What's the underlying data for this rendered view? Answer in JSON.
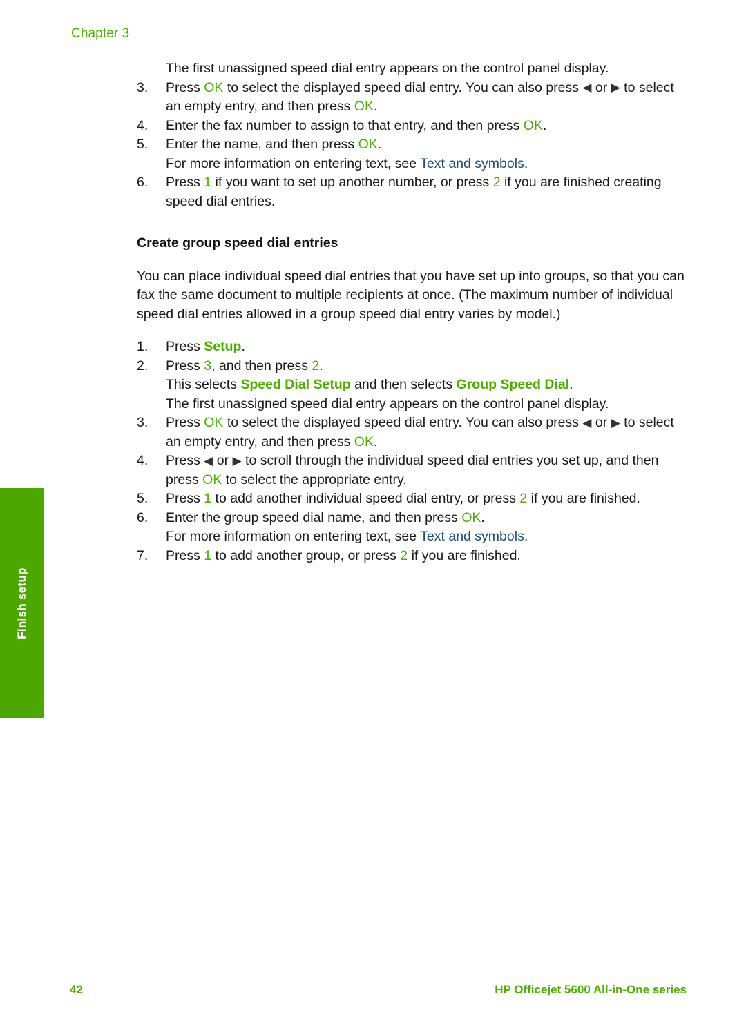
{
  "header": {
    "chapter_label": "Chapter 3"
  },
  "side_tab": {
    "label": "Finish setup",
    "color": "#4CA800"
  },
  "colors": {
    "accent_green": "#4CAF00",
    "link_blue": "#1F4E79",
    "body_text": "#1a1a1a"
  },
  "icons": {
    "left_arrow": "◀",
    "right_arrow": "▶"
  },
  "section_one": {
    "intro_line": "The first unassigned speed dial entry appears on the control panel display.",
    "steps": [
      {
        "num": "3.",
        "parts": [
          {
            "t": "Press ",
            "s": "plain"
          },
          {
            "t": "OK",
            "s": "green"
          },
          {
            "t": " to select the displayed speed dial entry. You can also press ",
            "s": "plain"
          },
          {
            "t": "◀",
            "s": "arrow"
          },
          {
            "t": " or ",
            "s": "plain"
          },
          {
            "t": "▶",
            "s": "arrow"
          },
          {
            "t": " to select an empty entry, and then press ",
            "s": "plain"
          },
          {
            "t": "OK",
            "s": "green"
          },
          {
            "t": ".",
            "s": "plain"
          }
        ]
      },
      {
        "num": "4.",
        "parts": [
          {
            "t": "Enter the fax number to assign to that entry, and then press ",
            "s": "plain"
          },
          {
            "t": "OK",
            "s": "green"
          },
          {
            "t": ".",
            "s": "plain"
          }
        ]
      },
      {
        "num": "5.",
        "parts": [
          {
            "t": "Enter the name, and then press ",
            "s": "plain"
          },
          {
            "t": "OK",
            "s": "green"
          },
          {
            "t": ".",
            "s": "plain"
          }
        ],
        "sub_parts": [
          {
            "t": "For more information on entering text, see ",
            "s": "plain"
          },
          {
            "t": "Text and symbols",
            "s": "link"
          },
          {
            "t": ".",
            "s": "plain"
          }
        ]
      },
      {
        "num": "6.",
        "parts": [
          {
            "t": "Press ",
            "s": "plain"
          },
          {
            "t": "1",
            "s": "green"
          },
          {
            "t": " if you want to set up another number, or press ",
            "s": "plain"
          },
          {
            "t": "2",
            "s": "green"
          },
          {
            "t": " if you are finished creating speed dial entries.",
            "s": "plain"
          }
        ]
      }
    ]
  },
  "section_two": {
    "heading": "Create group speed dial entries",
    "intro": "You can place individual speed dial entries that you have set up into groups, so that you can fax the same document to multiple recipients at once. (The maximum number of individual speed dial entries allowed in a group speed dial entry varies by model.)",
    "steps": [
      {
        "num": "1.",
        "parts": [
          {
            "t": "Press ",
            "s": "plain"
          },
          {
            "t": "Setup",
            "s": "green-bold"
          },
          {
            "t": ".",
            "s": "plain"
          }
        ]
      },
      {
        "num": "2.",
        "parts": [
          {
            "t": "Press ",
            "s": "plain"
          },
          {
            "t": "3",
            "s": "green"
          },
          {
            "t": ", and then press ",
            "s": "plain"
          },
          {
            "t": "2",
            "s": "green"
          },
          {
            "t": ".",
            "s": "plain"
          }
        ],
        "sub_parts": [
          {
            "t": "This selects ",
            "s": "plain"
          },
          {
            "t": "Speed Dial Setup",
            "s": "green-bold"
          },
          {
            "t": " and then selects ",
            "s": "plain"
          },
          {
            "t": "Group Speed Dial",
            "s": "green-bold"
          },
          {
            "t": ".",
            "s": "plain"
          }
        ],
        "sub_parts_2": [
          {
            "t": "The first unassigned speed dial entry appears on the control panel display.",
            "s": "plain"
          }
        ]
      },
      {
        "num": "3.",
        "parts": [
          {
            "t": "Press ",
            "s": "plain"
          },
          {
            "t": "OK",
            "s": "green"
          },
          {
            "t": " to select the displayed speed dial entry. You can also press ",
            "s": "plain"
          },
          {
            "t": "◀",
            "s": "arrow"
          },
          {
            "t": " or ",
            "s": "plain"
          },
          {
            "t": "▶",
            "s": "arrow"
          },
          {
            "t": " to select an empty entry, and then press ",
            "s": "plain"
          },
          {
            "t": "OK",
            "s": "green"
          },
          {
            "t": ".",
            "s": "plain"
          }
        ]
      },
      {
        "num": "4.",
        "parts": [
          {
            "t": "Press ",
            "s": "plain"
          },
          {
            "t": "◀",
            "s": "arrow"
          },
          {
            "t": " or ",
            "s": "plain"
          },
          {
            "t": "▶",
            "s": "arrow"
          },
          {
            "t": " to scroll through the individual speed dial entries you set up, and then press ",
            "s": "plain"
          },
          {
            "t": "OK",
            "s": "green"
          },
          {
            "t": " to select the appropriate entry.",
            "s": "plain"
          }
        ]
      },
      {
        "num": "5.",
        "parts": [
          {
            "t": "Press ",
            "s": "plain"
          },
          {
            "t": "1",
            "s": "green"
          },
          {
            "t": " to add another individual speed dial entry, or press ",
            "s": "plain"
          },
          {
            "t": "2",
            "s": "green"
          },
          {
            "t": " if you are finished.",
            "s": "plain"
          }
        ]
      },
      {
        "num": "6.",
        "parts": [
          {
            "t": "Enter the group speed dial name, and then press ",
            "s": "plain"
          },
          {
            "t": "OK",
            "s": "green"
          },
          {
            "t": ".",
            "s": "plain"
          }
        ],
        "sub_parts": [
          {
            "t": "For more information on entering text, see ",
            "s": "plain"
          },
          {
            "t": "Text and symbols",
            "s": "link"
          },
          {
            "t": ".",
            "s": "plain"
          }
        ]
      },
      {
        "num": "7.",
        "parts": [
          {
            "t": "Press ",
            "s": "plain"
          },
          {
            "t": "1",
            "s": "green"
          },
          {
            "t": " to add another group, or press ",
            "s": "plain"
          },
          {
            "t": "2",
            "s": "green"
          },
          {
            "t": " if you are finished.",
            "s": "plain"
          }
        ]
      }
    ]
  },
  "footer": {
    "page_number": "42",
    "product": "HP Officejet 5600 All-in-One series"
  }
}
